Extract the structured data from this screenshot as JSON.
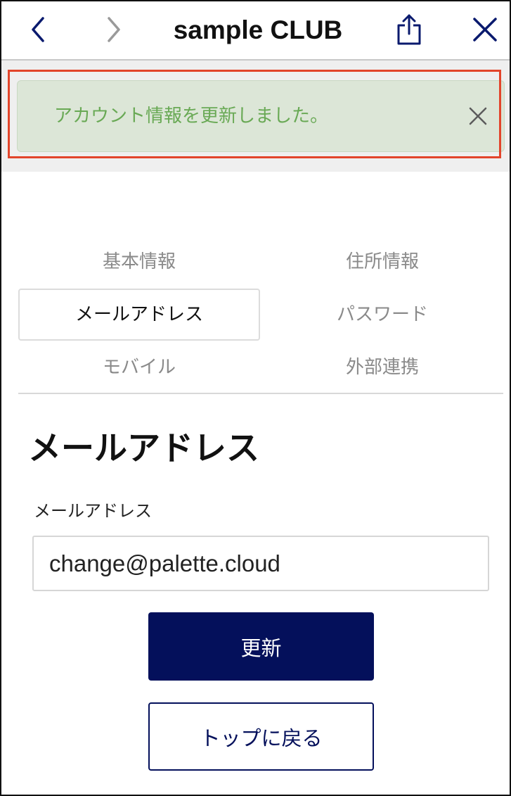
{
  "topbar": {
    "title": "sample CLUB",
    "back_icon": "chevron-left-icon",
    "forward_icon": "chevron-right-icon",
    "share_icon": "share-icon",
    "close_icon": "close-icon",
    "icon_color": "#0a1a6e",
    "disabled_icon_color": "#9a9a9a"
  },
  "notice": {
    "message": "アカウント情報を更新しました。",
    "close_icon": "close-icon",
    "text_color": "#69a955",
    "background": "#dce6d7",
    "highlight_color": "#e2452b"
  },
  "tabs": [
    {
      "label": "基本情報",
      "active": false
    },
    {
      "label": "住所情報",
      "active": false
    },
    {
      "label": "メールアドレス",
      "active": true
    },
    {
      "label": "パスワード",
      "active": false
    },
    {
      "label": "モバイル",
      "active": false
    },
    {
      "label": "外部連携",
      "active": false
    }
  ],
  "section": {
    "title": "メールアドレス",
    "field_label": "メールアドレス",
    "email_value": "change@palette.cloud"
  },
  "buttons": {
    "update_label": "更新",
    "back_to_top_label": "トップに戻る",
    "primary_color": "#04105b"
  }
}
